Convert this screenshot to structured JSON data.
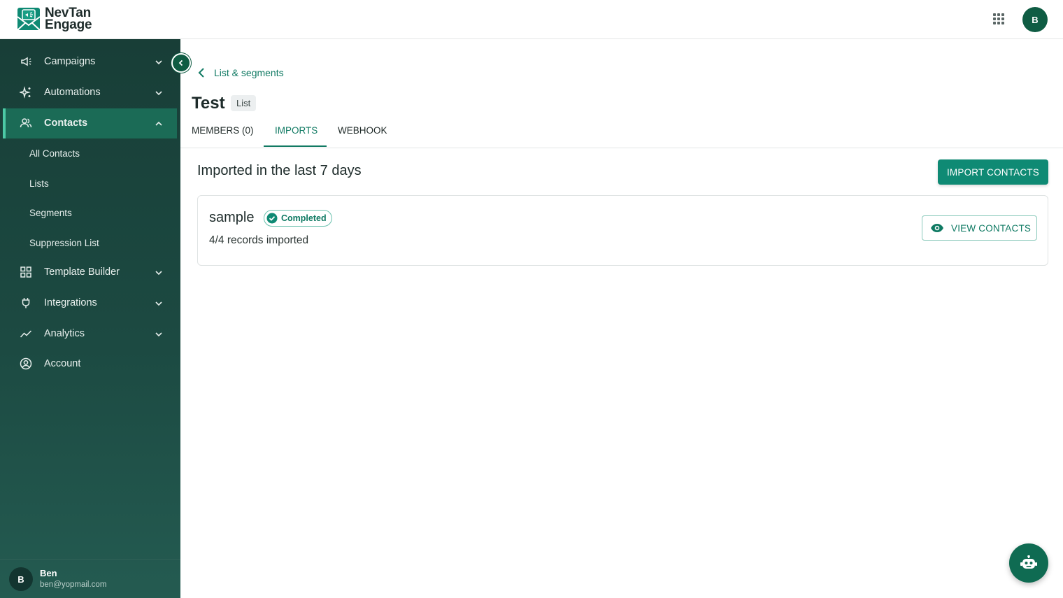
{
  "brand": {
    "line1": "NevTan",
    "line2": "Engage"
  },
  "header": {
    "avatar_initial": "B"
  },
  "sidebar": {
    "items": [
      {
        "label": "Campaigns",
        "icon": "megaphone-icon"
      },
      {
        "label": "Automations",
        "icon": "sparkles-icon"
      },
      {
        "label": "Contacts",
        "icon": "users-icon",
        "active": true
      },
      {
        "label": "Template Builder",
        "icon": "grid-icon"
      },
      {
        "label": "Integrations",
        "icon": "plug-icon"
      },
      {
        "label": "Analytics",
        "icon": "trend-icon"
      },
      {
        "label": "Account",
        "icon": "account-circle-icon"
      }
    ],
    "contacts_sub": [
      "All Contacts",
      "Lists",
      "Segments",
      "Suppression List"
    ],
    "user": {
      "initial": "B",
      "name": "Ben",
      "email": "ben@yopmail.com"
    }
  },
  "main": {
    "breadcrumb": "List & segments",
    "title": "Test",
    "title_badge": "List",
    "tabs": [
      {
        "label": "MEMBERS (0)"
      },
      {
        "label": "IMPORTS",
        "active": true
      },
      {
        "label": "WEBHOOK"
      }
    ],
    "section_title": "Imported in the last 7 days",
    "import_button": "IMPORT CONTACTS",
    "imports": [
      {
        "name": "sample",
        "status": "Completed",
        "records": "4/4 records imported",
        "view_button": "VIEW CONTACTS"
      }
    ]
  },
  "colors": {
    "sidebar_bg": "#1c4a42",
    "active_nav": "#1b6b56",
    "accent": "#117a63",
    "primary_button": "#0f8a74"
  }
}
